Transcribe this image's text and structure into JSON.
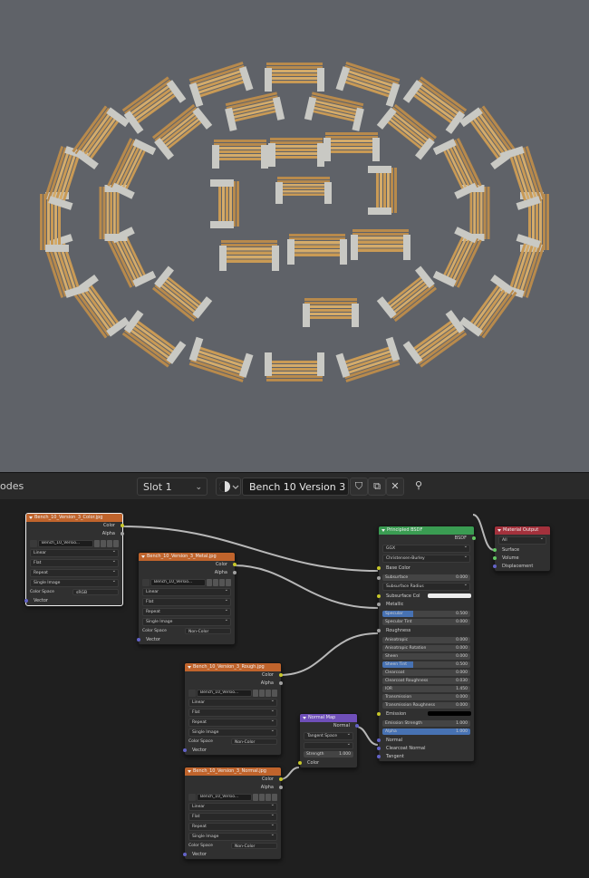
{
  "header": {
    "editor_label": "odes",
    "slot": "Slot 1",
    "material_name": "Bench 10 Version 3"
  },
  "nodes": {
    "tex_color": {
      "title": "Bench_10_Version_3_Color.jpg",
      "outputs": [
        "Color",
        "Alpha"
      ],
      "image": "Bench_10_Versio...",
      "options": [
        "Linear",
        "Flat",
        "Repeat",
        "Single Image"
      ],
      "colorspace_label": "Color Space",
      "colorspace": "sRGB",
      "vector": "Vector"
    },
    "tex_metal": {
      "title": "Bench_10_Version_3_Metal.jpg",
      "outputs": [
        "Color",
        "Alpha"
      ],
      "image": "Bench_10_Versio...",
      "options": [
        "Linear",
        "Flat",
        "Repeat",
        "Single Image"
      ],
      "colorspace_label": "Color Space",
      "colorspace": "Non-Color",
      "vector": "Vector"
    },
    "tex_rough": {
      "title": "Bench_10_Version_3_Rough.jpg",
      "outputs": [
        "Color",
        "Alpha"
      ],
      "image": "Bench_10_Versio...",
      "options": [
        "Linear",
        "Flat",
        "Repeat",
        "Single Image"
      ],
      "colorspace_label": "Color Space",
      "colorspace": "Non-Color",
      "vector": "Vector"
    },
    "tex_normal": {
      "title": "Bench_10_Version_3_Normal.jpg",
      "outputs": [
        "Color",
        "Alpha"
      ],
      "image": "Bench_10_Versio...",
      "options": [
        "Linear",
        "Flat",
        "Repeat",
        "Single Image"
      ],
      "colorspace_label": "Color Space",
      "colorspace": "Non-Color",
      "vector": "Vector"
    },
    "normal_map": {
      "title": "Normal Map",
      "output": "Normal",
      "space": "Tangent Space",
      "strength_label": "Strength",
      "strength": "1.000",
      "color": "Color"
    },
    "bsdf": {
      "title": "Principled BSDF",
      "output": "BSDF",
      "distribution": "GGX",
      "subsurface_method": "Christensen-Burley",
      "base_color": "Base Color",
      "subsurface": {
        "label": "Subsurface",
        "value": "0.000"
      },
      "subsurface_radius": "Subsurface Radius",
      "subsurface_color": "Subsurface Col",
      "metallic": "Metallic",
      "specular": {
        "label": "Specular",
        "value": "0.500"
      },
      "specular_tint": {
        "label": "Specular Tint",
        "value": "0.000"
      },
      "roughness": "Roughness",
      "anisotropic": {
        "label": "Anisotropic",
        "value": "0.000"
      },
      "anisotropic_rotation": {
        "label": "Anisotropic Rotation",
        "value": "0.000"
      },
      "sheen": {
        "label": "Sheen",
        "value": "0.000"
      },
      "sheen_tint": {
        "label": "Sheen Tint",
        "value": "0.500"
      },
      "clearcoat": {
        "label": "Clearcoat",
        "value": "0.000"
      },
      "clearcoat_roughness": {
        "label": "Clearcoat Roughness",
        "value": "0.030"
      },
      "ior": {
        "label": "IOR",
        "value": "1.450"
      },
      "transmission": {
        "label": "Transmission",
        "value": "0.000"
      },
      "transmission_roughness": {
        "label": "Transmission Roughness",
        "value": "0.000"
      },
      "emission": "Emission",
      "emission_strength": {
        "label": "Emission Strength",
        "value": "1.000"
      },
      "alpha": {
        "label": "Alpha",
        "value": "1.000"
      },
      "normal": "Normal",
      "clearcoat_normal": "Clearcoat Normal",
      "tangent": "Tangent"
    },
    "output": {
      "title": "Material Output",
      "target": "All",
      "inputs": [
        "Surface",
        "Volume",
        "Displacement"
      ]
    }
  },
  "colors": {
    "viewport_bg": "#5f6268",
    "node_texture_header": "#c0642c",
    "node_shader_header": "#3a9c52",
    "node_output_header": "#a3313c",
    "node_vector_header": "#6f4fb9",
    "wood": "#d4ab6a",
    "concrete": "#c9c9c4"
  }
}
